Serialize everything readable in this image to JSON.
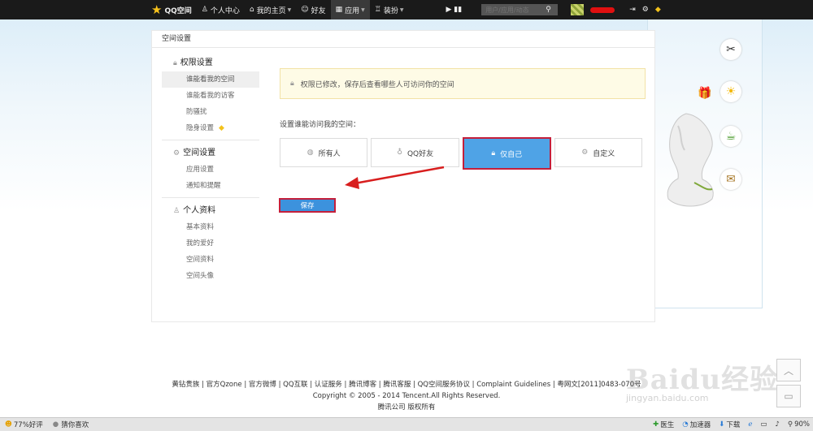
{
  "topbar": {
    "logo": "QQ空间",
    "items": [
      {
        "icon": "person-icon",
        "label": "个人中心"
      },
      {
        "icon": "home-icon",
        "label": "我的主页"
      },
      {
        "icon": "friends-icon",
        "label": "好友"
      },
      {
        "icon": "grid-icon",
        "label": "应用"
      },
      {
        "icon": "shirt-icon",
        "label": "装扮"
      }
    ],
    "search_placeholder": "用户/应用/动态"
  },
  "panel": {
    "title": "空间设置",
    "groups": [
      {
        "title": "权限设置",
        "items": [
          "谁能看我的空间",
          "谁能看我的访客",
          "防骚扰",
          "隐身设置"
        ]
      },
      {
        "title": "空间设置",
        "items": [
          "应用设置",
          "通知和提醒"
        ]
      },
      {
        "title": "个人资料",
        "items": [
          "基本资料",
          "我的爱好",
          "空间资料",
          "空间头像"
        ]
      }
    ],
    "notice": "权限已修改，保存后查看哪些人可访问你的空间",
    "label": "设置谁能访问我的空间：",
    "options": [
      "所有人",
      "QQ好友",
      "仅自己",
      "自定义"
    ],
    "selected_option": "仅自己",
    "save_label": "保存"
  },
  "footer": {
    "links": "黄钻贵族 | 官方Qzone | 官方微博 | QQ互联 | 认证服务 | 腾讯博客 | 腾讯客服 | QQ空间服务协议 | Complaint Guidelines | 粤网文[2011]0483-070号",
    "copyright": "Copyright © 2005 - 2014 Tencent.All Rights Reserved.",
    "company": "腾讯公司 版权所有"
  },
  "watermark": {
    "logo": "Baidu经验",
    "url": "jingyan.baidu.com"
  },
  "statusbar": {
    "rating": "77%好评",
    "guess": "猜你喜欢",
    "doctor": "医生",
    "accelerator": "加速器",
    "download": "下载",
    "zoom": "90%"
  },
  "colors": {
    "accent": "#4fa3e6",
    "highlight_border": "#c41f3b",
    "topbar": "#1a1a1a"
  }
}
